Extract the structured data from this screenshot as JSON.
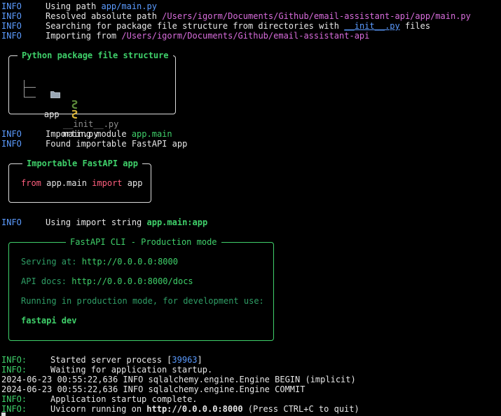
{
  "log_top": [
    {
      "level": "INFO",
      "text": "Using path ",
      "hl": "app/main.py",
      "tail": ""
    },
    {
      "level": "INFO",
      "text": "Resolved absolute path ",
      "hl": "/Users/igorm/Documents/Github/email-assistant-api/app/main.py",
      "tail": ""
    },
    {
      "level": "INFO",
      "text": "Searching for package file structure from directories with ",
      "hl": "__init__.py",
      "tail": " files"
    },
    {
      "level": "INFO",
      "text": "Importing from ",
      "hl": "/Users/igorm/Documents/Github/email-assistant-api",
      "tail": ""
    }
  ],
  "pkg_box": {
    "title": "Python package file structure",
    "folder": "app",
    "files": [
      "__init__.py",
      "main.py"
    ]
  },
  "log_mid": [
    {
      "level": "INFO",
      "text": "Importing module ",
      "hl": "app.main"
    },
    {
      "level": "INFO",
      "text": "Found importable FastAPI app",
      "hl": ""
    }
  ],
  "import_box": {
    "title": "Importable FastAPI app",
    "kw_from": "from",
    "module": "app.main",
    "kw_import": "import",
    "name": "app"
  },
  "import_string_line": {
    "level": "INFO",
    "text": "Using import string ",
    "hl": "app.main:app"
  },
  "cli_box": {
    "title": "FastAPI CLI - Production mode",
    "serving_label": "Serving at: ",
    "serving_url": "http://0.0.0.0:8000",
    "docs_label": "API docs: ",
    "docs_url": "http://0.0.0.0:8000/docs",
    "note": "Running in production mode, for development use:",
    "command": "fastapi dev"
  },
  "log_bottom": {
    "started_level": "INFO:",
    "started_text": "Started server process [",
    "pid": "39963",
    "started_tail": "]",
    "waiting_level": "INFO:",
    "waiting_text": "Waiting for application startup.",
    "sql1": "2024-06-23 00:55:22,636 INFO sqlalchemy.engine.Engine BEGIN (implicit)",
    "sql2": "2024-06-23 00:55:22,636 INFO sqlalchemy.engine.Engine COMMIT",
    "complete_level": "INFO:",
    "complete_text": "Application startup complete.",
    "uvicorn_level": "INFO:",
    "uvicorn_text": "Uvicorn running on ",
    "uvicorn_url": "http://0.0.0.0:8000",
    "uvicorn_tail": " (Press CTRL+C to quit)"
  },
  "colors": {
    "background": "#000000",
    "info": "#5b9bff",
    "path": "#d86ddc",
    "green": "#3fd06a",
    "keyword": "#ff5f7e"
  },
  "icons": {
    "folder": "folder-icon",
    "python_file": "python-snake-icon"
  }
}
